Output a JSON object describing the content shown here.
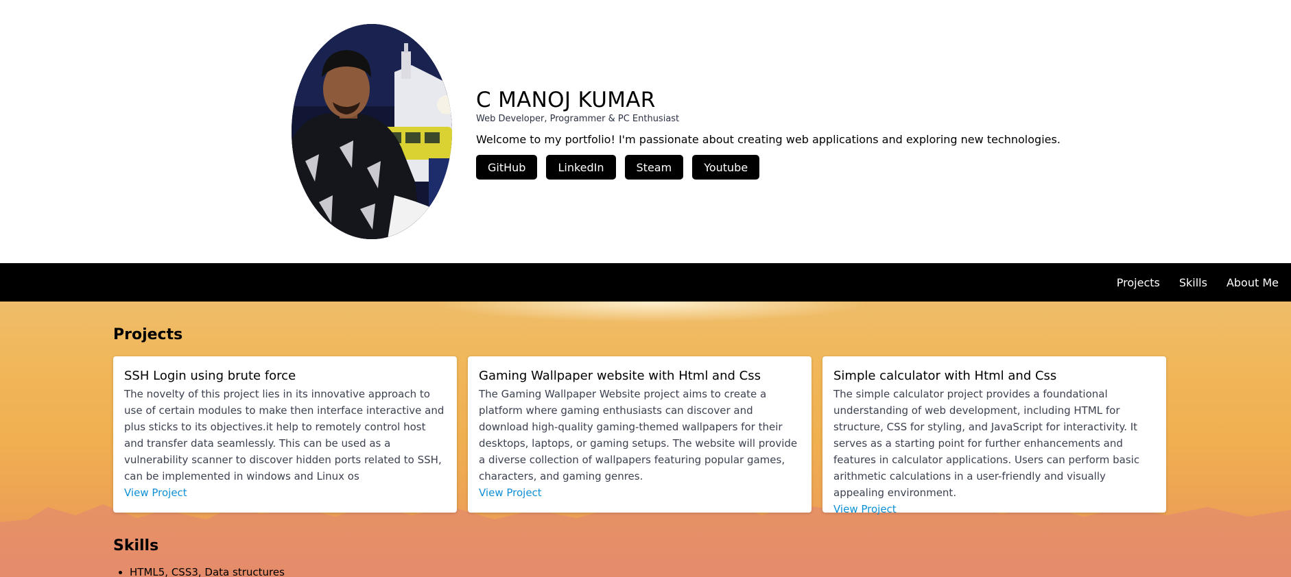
{
  "profile": {
    "name": "C MANOJ KUMAR",
    "tagline": "Web Developer, Programmer & PC Enthusiast",
    "welcome": "Welcome to my portfolio! I'm passionate about creating web applications and exploring new technologies.",
    "social_links": [
      "GitHub",
      "LinkedIn",
      "Steam",
      "Youtube"
    ]
  },
  "nav": {
    "items": [
      "Projects",
      "Skills",
      "About Me"
    ]
  },
  "projects": {
    "title": "Projects",
    "items": [
      {
        "title": "SSH Login using brute force",
        "description": "The novelty of this project lies in its innovative approach to use of certain modules to make then interface interactive and plus sticks to its objectives.it help to remotely control host and transfer data seamlessly. This can be used as a vulnerability scanner to discover hidden ports related to SSH, can be implemented in windows and Linux os",
        "link": "View Project"
      },
      {
        "title": "Gaming Wallpaper website with Html and Css",
        "description": "The Gaming Wallpaper Website project aims to create a platform where gaming enthusiasts can discover and download high-quality gaming-themed wallpapers for their desktops, laptops, or gaming setups. The website will provide a diverse collection of wallpapers featuring popular games, characters, and gaming genres.",
        "link": "View Project"
      },
      {
        "title": "Simple calculator with Html and Css",
        "description": "The simple calculator project provides a foundational understanding of web development, including HTML for structure, CSS for styling, and JavaScript for interactivity. It serves as a starting point for further enhancements and features in calculator applications. Users can perform basic arithmetic calculations in a user-friendly and visually appealing environment.",
        "link": "View Project"
      }
    ]
  },
  "skills": {
    "title": "Skills",
    "items": [
      "HTML5, CSS3, Data structures"
    ]
  },
  "colors": {
    "nav_background": "#000000",
    "button_background": "#000000",
    "link": "#0d8fd6",
    "sunset_top": "#eebd6a",
    "sunset_bottom": "#e89266"
  }
}
